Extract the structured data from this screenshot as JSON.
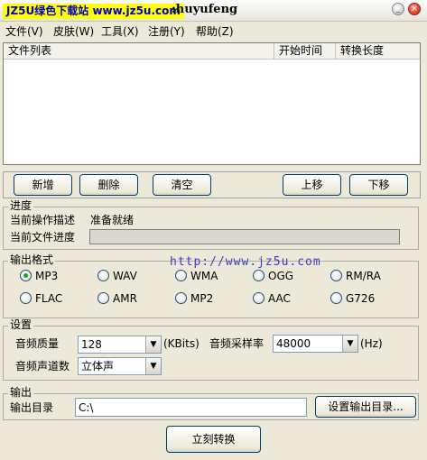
{
  "window": {
    "watermark": "JZ5U绿色下载站 www.jz5u.com",
    "title": ":huyufeng",
    "minimize": "_",
    "close": "×"
  },
  "menu": [
    {
      "label": "文件(V)"
    },
    {
      "label": "皮肤(W)"
    },
    {
      "label": "工具(X)"
    },
    {
      "label": "注册(Y)"
    },
    {
      "label": "帮助(Z)"
    }
  ],
  "filelist": {
    "columns": [
      "文件列表",
      "开始时间",
      "转换长度"
    ]
  },
  "toolbar": {
    "add": "新增",
    "delete": "删除",
    "clear": "清空",
    "move_up": "上移",
    "move_down": "下移"
  },
  "progress": {
    "legend": "进度",
    "op_label": "当前操作描述",
    "op_value": "准备就绪",
    "file_label": "当前文件进度",
    "file_progress": 0
  },
  "format": {
    "legend": "输出格式",
    "url": "http://www.jz5u.com",
    "selected": "MP3",
    "options": [
      "MP3",
      "WAV",
      "WMA",
      "OGG",
      "RM/RA",
      "FLAC",
      "AMR",
      "MP2",
      "AAC",
      "G726"
    ]
  },
  "settings": {
    "legend": "设置",
    "quality_label": "音频质量",
    "quality_value": "128",
    "quality_unit": "(KBits)",
    "rate_label": "音频采样率",
    "rate_value": "48000",
    "rate_unit": "(Hz)",
    "channel_label": "音频声道数",
    "channel_value": "立体声"
  },
  "output": {
    "legend": "输出",
    "dir_label": "输出目录",
    "dir_value": "C:\\",
    "set_dir_button": "设置输出目录...",
    "convert_button": "立刻转换"
  }
}
